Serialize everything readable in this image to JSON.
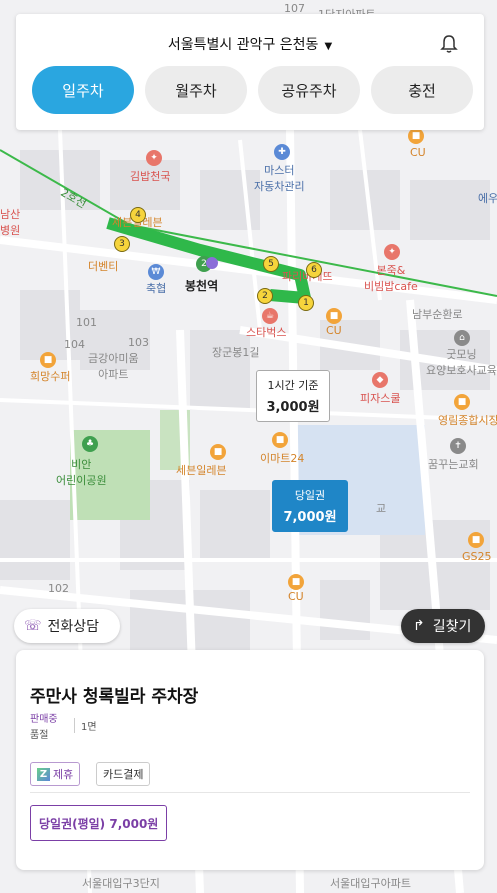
{
  "header": {
    "location": "서울특별시 관악구 은천동",
    "tabs": [
      {
        "label": "일주차",
        "active": true
      },
      {
        "label": "월주차",
        "active": false
      },
      {
        "label": "공유주차",
        "active": false
      },
      {
        "label": "충전",
        "active": false
      }
    ]
  },
  "map": {
    "station": "봉천역",
    "line_label": "2호선",
    "pois": {
      "kimbap": "김밥천국",
      "master": "마스터\n자동차관리",
      "seven1": "세븐일레븐",
      "seven2": "세븐일레븐",
      "the_venti": "더벤티",
      "nonghyup": "축협",
      "paris": "파리바게뜨",
      "bonjuk": "본죽&\n비빔밥cafe",
      "starbucks": "스타벅스",
      "cu1": "CU",
      "cu2": "CU",
      "cu3": "CU",
      "emart24": "이마트24",
      "pizza": "피자스쿨",
      "yeongrim": "영림종합시장",
      "goodmorning": "굿모닝\n요양보호사교육",
      "kkumkkun": "꿈꾸는교회",
      "gs25": "GS25",
      "hope": "희망수퍼",
      "bian": "비안\n어린이공원",
      "kumkang": "금강아미움\n아파트",
      "nambu": "남부순환로",
      "jangseong": "장군봉1길",
      "seoul_univ": "서울대입구3단지",
      "seoul_univ2": "서울대입구아파트",
      "namsan": "남산\n병원",
      "ewha": "에우",
      "cu_top": "1단지아파트",
      "b107": "107",
      "b101": "101",
      "b103": "103",
      "b104": "104",
      "b102": "102",
      "gyo": "교"
    },
    "route_stops": [
      "1",
      "2",
      "3",
      "4",
      "5",
      "6"
    ],
    "price_tags": [
      {
        "label": "1시간 기준",
        "amount": "3,000원"
      },
      {
        "label": "당일권",
        "amount": "7,000원"
      }
    ]
  },
  "buttons": {
    "call": "전화상담",
    "directions": "길찾기"
  },
  "sheet": {
    "title": "주만사 청록빌라 주차장",
    "status": "판매중",
    "floor_label": "품절",
    "slots": "1면",
    "chips": [
      "제휴",
      "카드결제"
    ],
    "partner_icon": "Z",
    "ticket": "당일권(평일) 7,000원"
  },
  "colors": {
    "accent": "#2aa6e0",
    "route": "#2fb84a",
    "selected_tag": "#1f86c7",
    "purple": "#7b3fa6"
  }
}
